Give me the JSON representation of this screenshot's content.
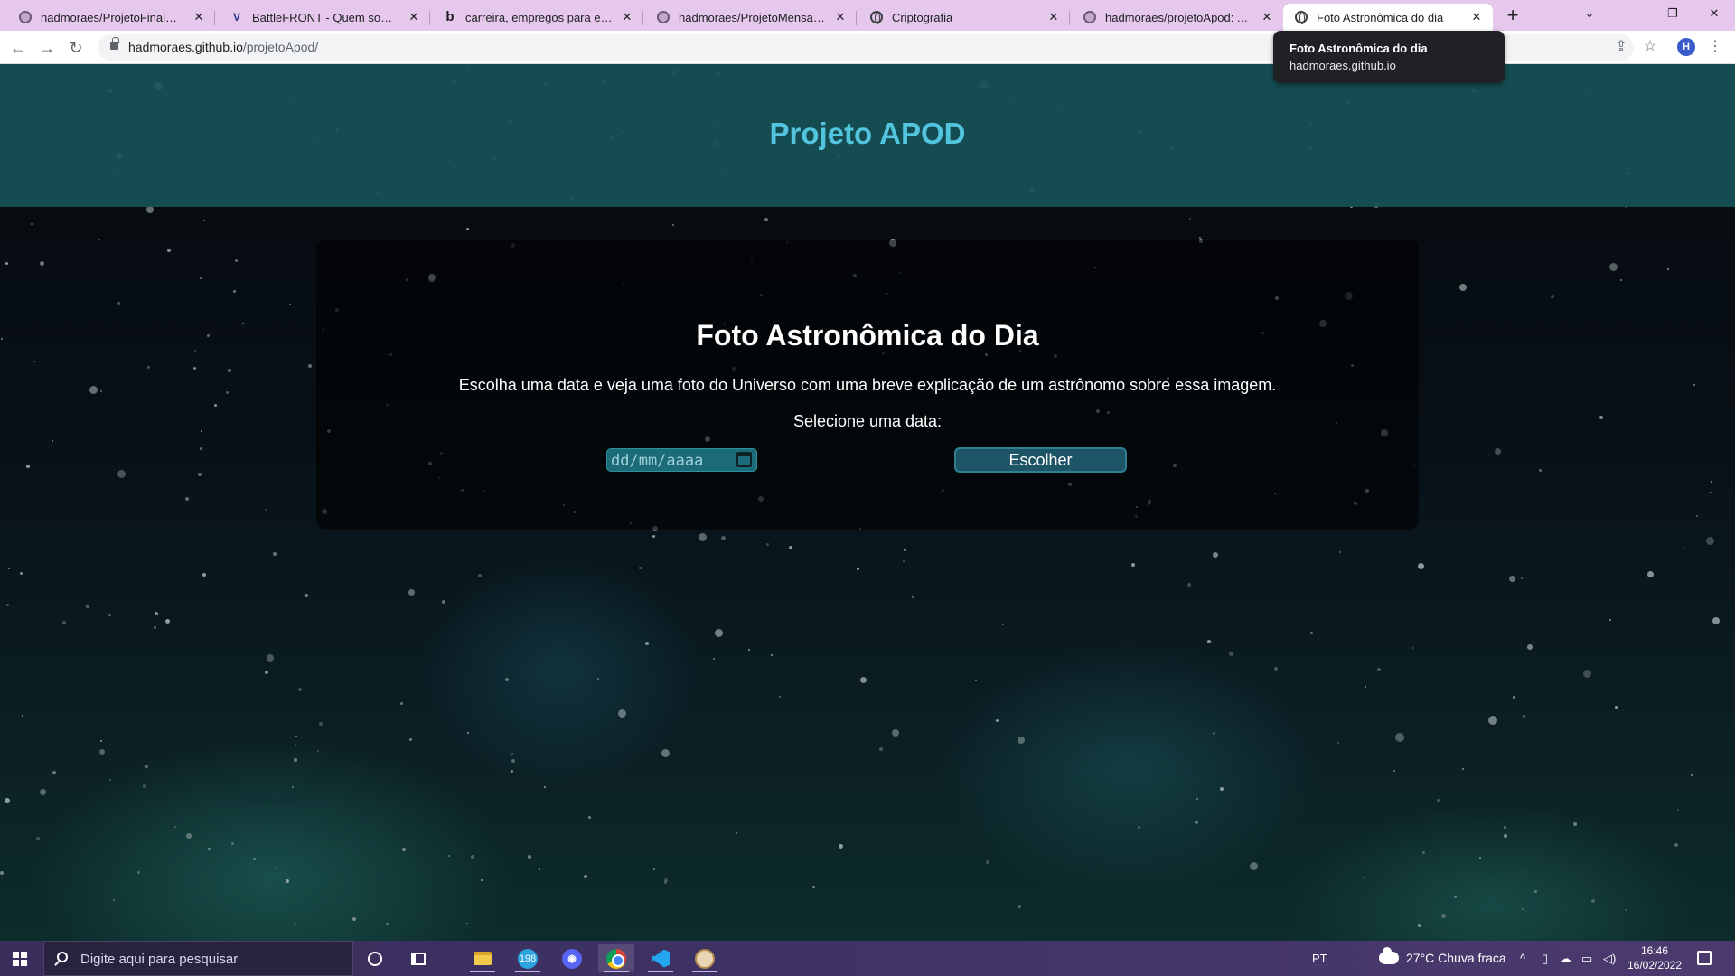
{
  "browser": {
    "tabs": [
      {
        "title": "hadmoraes/ProjetoFinalModulo",
        "icon": "github-icon"
      },
      {
        "title": "BattleFRONT - Quem somos nós",
        "icon": "battlefront-icon"
      },
      {
        "title": "carreira, empregos para estágio",
        "icon": "b-icon"
      },
      {
        "title": "hadmoraes/ProjetoMensagemC",
        "icon": "github-icon"
      },
      {
        "title": "Criptografia",
        "icon": "globe-icon"
      },
      {
        "title": "hadmoraes/projetoApod: A Nas",
        "icon": "github-icon"
      },
      {
        "title": "Foto Astronômica do dia",
        "icon": "globe-icon",
        "active": true
      }
    ],
    "new_tab_label": "+",
    "url_host": "hadmoraes.github.io",
    "url_path": "/projetoApod/",
    "profile_initial": "H",
    "tooltip": {
      "title": "Foto Astronômica do dia",
      "host": "hadmoraes.github.io"
    }
  },
  "page": {
    "header_title": "Projeto APOD",
    "main_title": "Foto Astronômica do Dia",
    "description": "Escolha uma data e veja uma foto do Universo com uma breve explicação de um astrônomo sobre essa imagem.",
    "select_label": "Selecione uma data:",
    "date_placeholder": "dd/mm/aaaa",
    "choose_button": "Escolher",
    "colors": {
      "header_bg": "#165258",
      "header_title": "#52c4de",
      "input_bg": "#1b6b78",
      "button_bg": "#1d5566"
    }
  },
  "taskbar": {
    "search_placeholder": "Digite aqui para pesquisar",
    "telegram_badge": "198",
    "language": "PT",
    "weather": "27°C  Chuva fraca",
    "time": "16:46",
    "date": "16/02/2022"
  }
}
